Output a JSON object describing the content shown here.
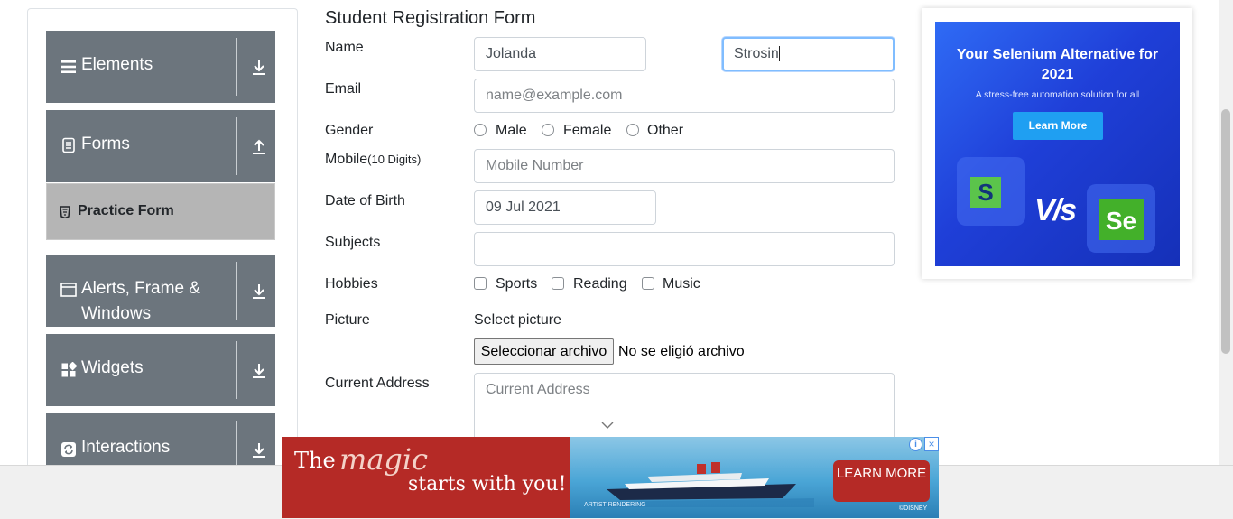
{
  "sidebar": {
    "groups": [
      {
        "label": "Elements",
        "icon": "hamburger-icon",
        "arrow": "download-arrow-icon"
      },
      {
        "label": "Forms",
        "icon": "document-icon",
        "arrow": "upload-arrow-icon"
      },
      {
        "label_line1": "Alerts, Frame &",
        "label_line2": "Windows",
        "icon": "window-icon",
        "arrow": "download-arrow-icon"
      },
      {
        "label": "Widgets",
        "icon": "widgets-icon",
        "arrow": "download-arrow-icon"
      },
      {
        "label": "Interactions",
        "icon": "refresh-icon",
        "arrow": "download-arrow-icon"
      }
    ],
    "active_item": {
      "label": "Practice Form",
      "icon": "html5-icon"
    },
    "colors": {
      "group_bg": "#6c757d",
      "active_bg": "#b5b5b5"
    }
  },
  "form": {
    "title": "Student Registration Form",
    "name": {
      "label": "Name",
      "first_value": "Jolanda",
      "last_value": "Strosin"
    },
    "email": {
      "label": "Email",
      "placeholder": "name@example.com"
    },
    "gender": {
      "label": "Gender",
      "options": [
        "Male",
        "Female",
        "Other"
      ]
    },
    "mobile": {
      "label": "Mobile",
      "hint": "(10 Digits)",
      "placeholder": "Mobile Number"
    },
    "dob": {
      "label": "Date of Birth",
      "value": "09 Jul 2021"
    },
    "subjects": {
      "label": "Subjects",
      "value": ""
    },
    "hobbies": {
      "label": "Hobbies",
      "options": [
        "Sports",
        "Reading",
        "Music"
      ]
    },
    "picture": {
      "label": "Picture",
      "select_text": "Select picture",
      "button": "Seleccionar archivo",
      "status": "No se eligió archivo"
    },
    "address": {
      "label": "Current Address",
      "placeholder": "Current Address"
    },
    "focus_color": "#80bdff"
  },
  "side_ad": {
    "title": "Your Selenium Alternative for 2021",
    "subtitle": "A stress-free automation solution for all",
    "button": "Learn More",
    "vs_text": "V/s",
    "logo_left": "S",
    "logo_right": "Se"
  },
  "bottom_ad": {
    "the": "The",
    "magic": "magic",
    "starts": "starts with you!",
    "cta": "LEARN MORE",
    "artist": "ARTIST RENDERING",
    "brand": "©DISNEY",
    "info": "i",
    "close": "×"
  }
}
